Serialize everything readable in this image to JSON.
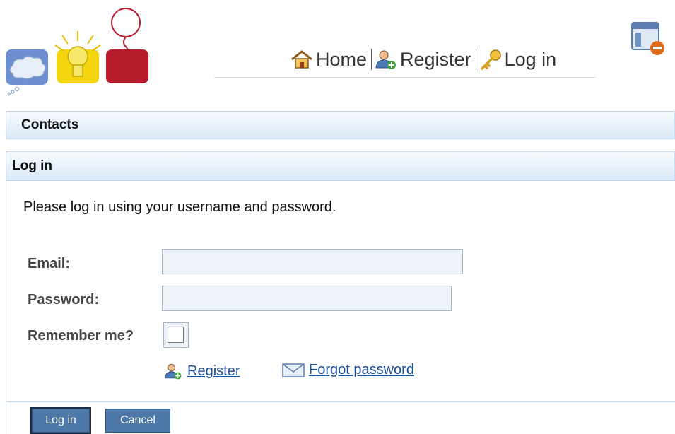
{
  "nav": {
    "items": [
      {
        "label": "Home",
        "icon": "home-icon"
      },
      {
        "label": "Register",
        "icon": "user-add-icon"
      },
      {
        "label": "Log in",
        "icon": "key-icon"
      }
    ]
  },
  "contacts": {
    "title": "Contacts"
  },
  "login": {
    "title": "Log in",
    "intro": "Please log in using your username and password.",
    "email_label": "Email:",
    "email_value": "",
    "password_label": "Password:",
    "password_value": "",
    "remember_label": "Remember me?",
    "remember_checked": false,
    "register_link": "Register",
    "forgot_link": "Forgot password",
    "login_button": "Log in",
    "cancel_button": "Cancel"
  },
  "colors": {
    "header_bg": "#dbe9f7",
    "button_bg": "#4d78a8",
    "link": "#1a4f97"
  }
}
